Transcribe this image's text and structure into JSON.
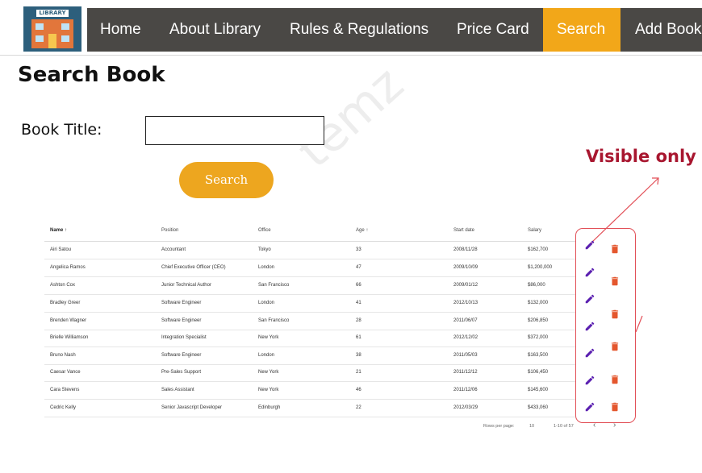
{
  "logo": {
    "text": "LIBRARY"
  },
  "nav": {
    "items": [
      {
        "label": "Home"
      },
      {
        "label": "About Library"
      },
      {
        "label": "Rules & Regulations"
      },
      {
        "label": "Price Card"
      },
      {
        "label": "Search",
        "active": true
      },
      {
        "label": "Add Book"
      }
    ]
  },
  "page": {
    "title": "Search Book",
    "book_title_label": "Book Title:",
    "book_title_value": "",
    "search_button": "Search",
    "watermark": "temz",
    "callout": "Visible only t"
  },
  "table": {
    "columns": [
      "Name ↑",
      "Position",
      "Office",
      "Age ↑",
      "Start date",
      "Salary"
    ],
    "rows": [
      [
        "Airi Satou",
        "Accountant",
        "Tokyo",
        "33",
        "2008/11/28",
        "$162,700"
      ],
      [
        "Angelica Ramos",
        "Chief Executive Officer (CEO)",
        "London",
        "47",
        "2009/10/09",
        "$1,200,000"
      ],
      [
        "Ashton Cox",
        "Junior Technical Author",
        "San Francisco",
        "66",
        "2009/01/12",
        "$86,000"
      ],
      [
        "Bradley Greer",
        "Software Engineer",
        "London",
        "41",
        "2012/10/13",
        "$132,000"
      ],
      [
        "Brenden Wagner",
        "Software Engineer",
        "San Francisco",
        "28",
        "2011/06/07",
        "$206,850"
      ],
      [
        "Brielle Williamson",
        "Integration Specialist",
        "New York",
        "61",
        "2012/12/02",
        "$372,000"
      ],
      [
        "Bruno Nash",
        "Software Engineer",
        "London",
        "38",
        "2011/05/03",
        "$163,500"
      ],
      [
        "Caesar Vance",
        "Pre-Sales Support",
        "New York",
        "21",
        "2011/12/12",
        "$106,450"
      ],
      [
        "Cara Stevens",
        "Sales Assistant",
        "New York",
        "46",
        "2011/12/06",
        "$145,600"
      ],
      [
        "Cedric Kelly",
        "Senior Javascript Developer",
        "Edinburgh",
        "22",
        "2012/03/29",
        "$433,060"
      ]
    ],
    "pager": {
      "rows_per_page_label": "Rows per page:",
      "rows_per_page_value": "10",
      "range": "1-10 of 57",
      "prev": "‹",
      "next": "›"
    }
  },
  "icons": {
    "edit": "pencil-icon",
    "delete": "trash-icon",
    "edit_color": "#5a1fb0",
    "delete_color": "#e4572e"
  }
}
